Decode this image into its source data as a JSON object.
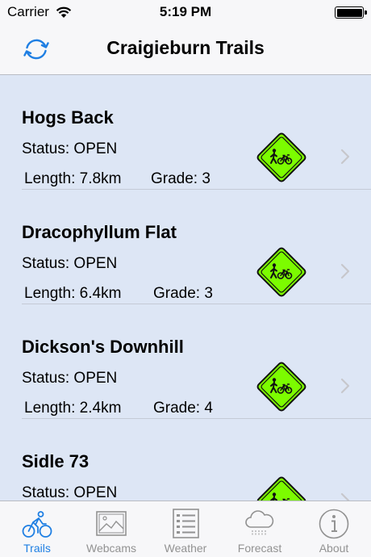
{
  "status_bar": {
    "carrier": "Carrier",
    "time": "5:19 PM"
  },
  "nav": {
    "title": "Craigieburn Trails"
  },
  "labels": {
    "status_prefix": "Status: ",
    "length_prefix": "Length: ",
    "grade_prefix": "Grade: "
  },
  "trails": [
    {
      "name": "Hogs Back",
      "status": "OPEN",
      "length": "7.8km",
      "grade": "3"
    },
    {
      "name": "Dracophyllum Flat",
      "status": "OPEN",
      "length": "6.4km",
      "grade": "3"
    },
    {
      "name": "Dickson's Downhill",
      "status": "OPEN",
      "length": "2.4km",
      "grade": "4"
    },
    {
      "name": "Sidle 73",
      "status": "OPEN",
      "length": "",
      "grade": ""
    }
  ],
  "tabs": [
    {
      "id": "trails",
      "label": "Trails",
      "icon": "bicycle-icon",
      "active": true
    },
    {
      "id": "webcams",
      "label": "Webcams",
      "icon": "photo-icon",
      "active": false
    },
    {
      "id": "weather",
      "label": "Weather",
      "icon": "list-icon",
      "active": false
    },
    {
      "id": "forecast",
      "label": "Forecast",
      "icon": "cloud-rain-icon",
      "active": false
    },
    {
      "id": "about",
      "label": "About",
      "icon": "info-icon",
      "active": false
    }
  ],
  "colors": {
    "accent": "#1f7fe3",
    "list_background": "#dde6f5",
    "sign_green": "#7cfc00",
    "inactive": "#929292"
  }
}
